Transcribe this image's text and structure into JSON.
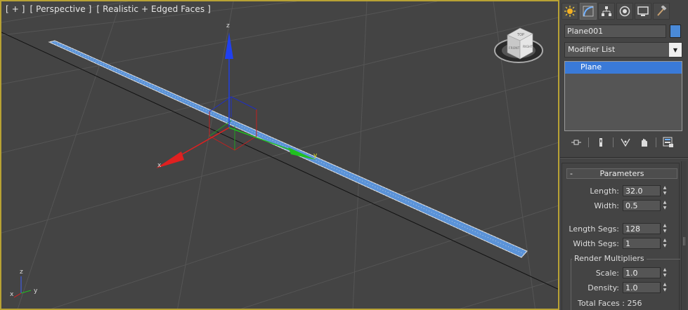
{
  "viewport": {
    "label_parts": [
      "[ + ]",
      "[ Perspective ]",
      "[ Realistic + Edged Faces ]"
    ],
    "gizmo_axes": {
      "z": "z",
      "y": "y",
      "x": "x"
    },
    "corner_axes": {
      "z": "z",
      "y": "y",
      "x": "x"
    },
    "viewcube_faces": {
      "top": "TOP",
      "front": "FRONT",
      "right": "RIGHT"
    }
  },
  "panel": {
    "tabs": [
      {
        "name": "create-tab",
        "icon": "sun-star-icon"
      },
      {
        "name": "modify-tab",
        "icon": "modify-curve-icon"
      },
      {
        "name": "hierarchy-tab",
        "icon": "hierarchy-icon"
      },
      {
        "name": "motion-tab",
        "icon": "motion-icon"
      },
      {
        "name": "display-tab",
        "icon": "display-monitor-icon"
      },
      {
        "name": "utilities-tab",
        "icon": "hammer-icon"
      }
    ],
    "object_name": "Plane001",
    "object_color": "#4a8ad8",
    "modifier_list": "Modifier List",
    "stack": [
      "Plane"
    ],
    "parameters": {
      "title": "Parameters",
      "collapse": "-",
      "length_label": "Length:",
      "length": "32.0",
      "width_label": "Width:",
      "width": "0.5",
      "length_segs_label": "Length Segs:",
      "length_segs": "128",
      "width_segs_label": "Width Segs:",
      "width_segs": "1",
      "render_multipliers": "Render Multipliers",
      "scale_label": "Scale:",
      "scale": "1.0",
      "density_label": "Density:",
      "density": "1.0",
      "total_faces": "Total Faces : 256"
    }
  },
  "colors": {
    "selection": "#3a7ad8",
    "viewport_border": "#b8a234",
    "axis_x": "#e02020",
    "axis_y": "#20c020",
    "axis_z": "#2040e0"
  }
}
